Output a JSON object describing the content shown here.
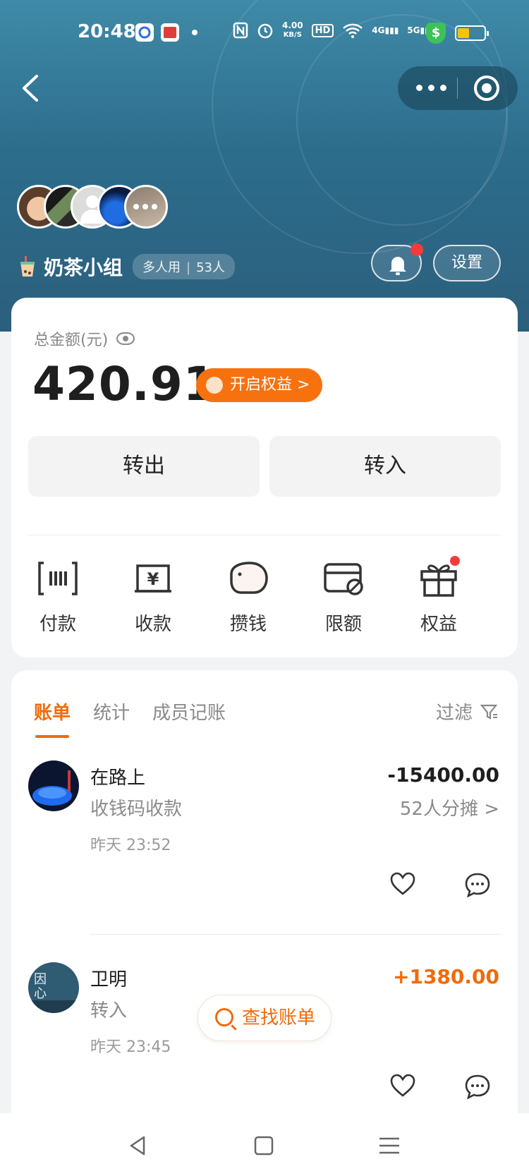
{
  "status_bar": {
    "time": "20:48",
    "speed": "4.00",
    "speed_unit": "KB/S",
    "hd": "HD",
    "net1": "4G",
    "net2": "5G"
  },
  "nav": {
    "back_icon": "back-arrow-icon",
    "more_icon": "more-dots-icon",
    "close_icon": "target-icon"
  },
  "group": {
    "name": "奶茶小组",
    "tag_mode": "多人用",
    "tag_count": "53人",
    "settings_label": "设置"
  },
  "balance": {
    "label": "总金额(元)",
    "amount": "420.91",
    "benefit_button": "开启权益 >",
    "transfer_out": "转出",
    "transfer_in": "转入"
  },
  "shortcuts": [
    {
      "label": "付款",
      "icon": "pay-icon"
    },
    {
      "label": "收款",
      "icon": "receive-icon"
    },
    {
      "label": "攒钱",
      "icon": "piggy-bank-icon"
    },
    {
      "label": "限额",
      "icon": "limit-card-icon"
    },
    {
      "label": "权益",
      "icon": "gift-icon"
    }
  ],
  "bills": {
    "tabs": [
      "账单",
      "统计",
      "成员记账"
    ],
    "filter_label": "过滤",
    "items": [
      {
        "name": "在路上",
        "desc": "收钱码收款",
        "time": "昨天 23:52",
        "amount": "-15400.00",
        "split": "52人分摊 >"
      },
      {
        "name": "卫明",
        "desc": "转入",
        "time": "昨天 23:45",
        "amount": "+1380.00"
      }
    ],
    "find_button": "查找账单"
  },
  "colors": {
    "accent": "#f06b0a",
    "header": "#2d6d8c",
    "badge": "#f43b3b"
  }
}
